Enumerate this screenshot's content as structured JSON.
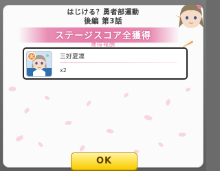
{
  "header": {
    "line1": "はじける？勇者部運動",
    "line2": "後編 第3話"
  },
  "banner": {
    "title": "ステージスコア全獲得",
    "subtitle": "獲得報酬"
  },
  "reward": {
    "element_badge": "火",
    "name": "三好夏凜",
    "quantity": "x2"
  },
  "ok_button": {
    "label": "OK"
  },
  "icons": {
    "element": "fire-element-icon",
    "mascot": "character-mascot-icon"
  },
  "colors": {
    "banner_pink": "#e57aa8",
    "ok_yellow": "#ffe24d",
    "dialog_bg": "#fbfbfb"
  }
}
